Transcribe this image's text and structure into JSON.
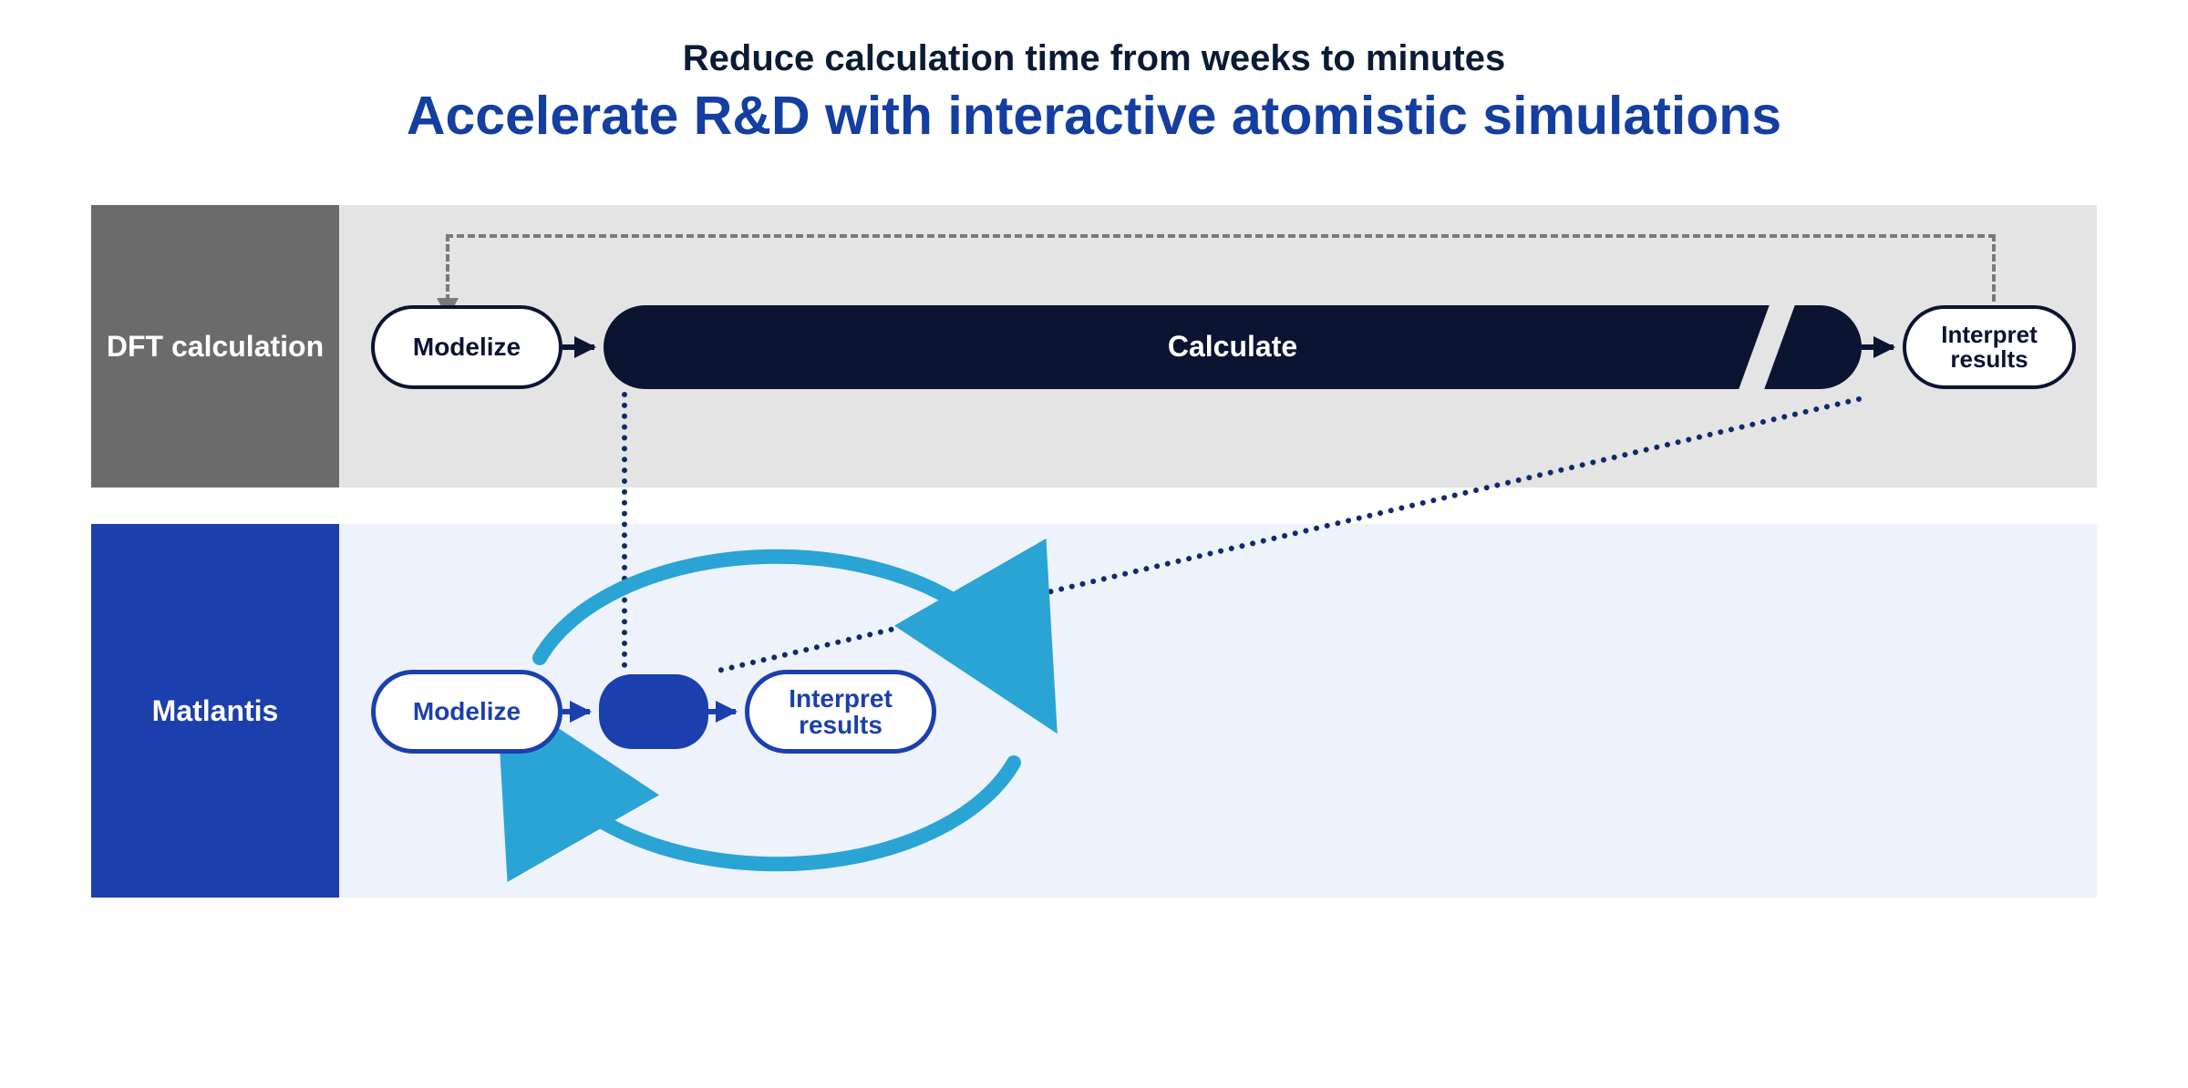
{
  "header": {
    "subtitle": "Reduce calculation time from weeks to minutes",
    "title": "Accelerate R&D with interactive atomistic simulations"
  },
  "rows": {
    "dft": {
      "label": "DFT calculation",
      "steps": {
        "modelize": "Modelize",
        "calculate": "Calculate",
        "interpret": "Interpret results"
      }
    },
    "matlantis": {
      "label": "Matlantis",
      "steps": {
        "modelize": "Modelize",
        "interpret": "Interpret results"
      }
    }
  },
  "colors": {
    "accent_blue": "#1b3fac",
    "dark": "#0b1430",
    "cyan": "#2aa4d4",
    "grey": "#6b6b6b"
  }
}
